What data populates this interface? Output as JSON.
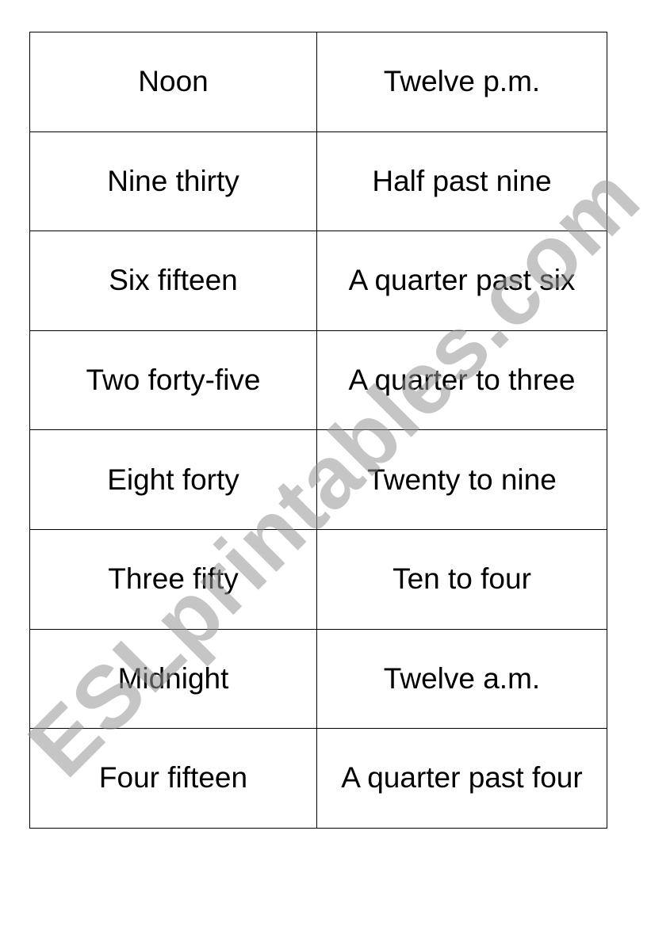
{
  "worksheet": {
    "rows": [
      {
        "digital": "Noon",
        "spoken": "Twelve p.m."
      },
      {
        "digital": "Nine thirty",
        "spoken": "Half past nine"
      },
      {
        "digital": "Six fifteen",
        "spoken": "A quarter past six"
      },
      {
        "digital": "Two forty-five",
        "spoken": "A quarter to three"
      },
      {
        "digital": "Eight forty",
        "spoken": "Twenty to nine"
      },
      {
        "digital": "Three fifty",
        "spoken": "Ten to four"
      },
      {
        "digital": "Midnight",
        "spoken": "Twelve a.m."
      },
      {
        "digital": "Four fifteen",
        "spoken": "A quarter past four"
      }
    ]
  },
  "watermark": {
    "text": "ESLprintables.com",
    "color": "#969696"
  }
}
